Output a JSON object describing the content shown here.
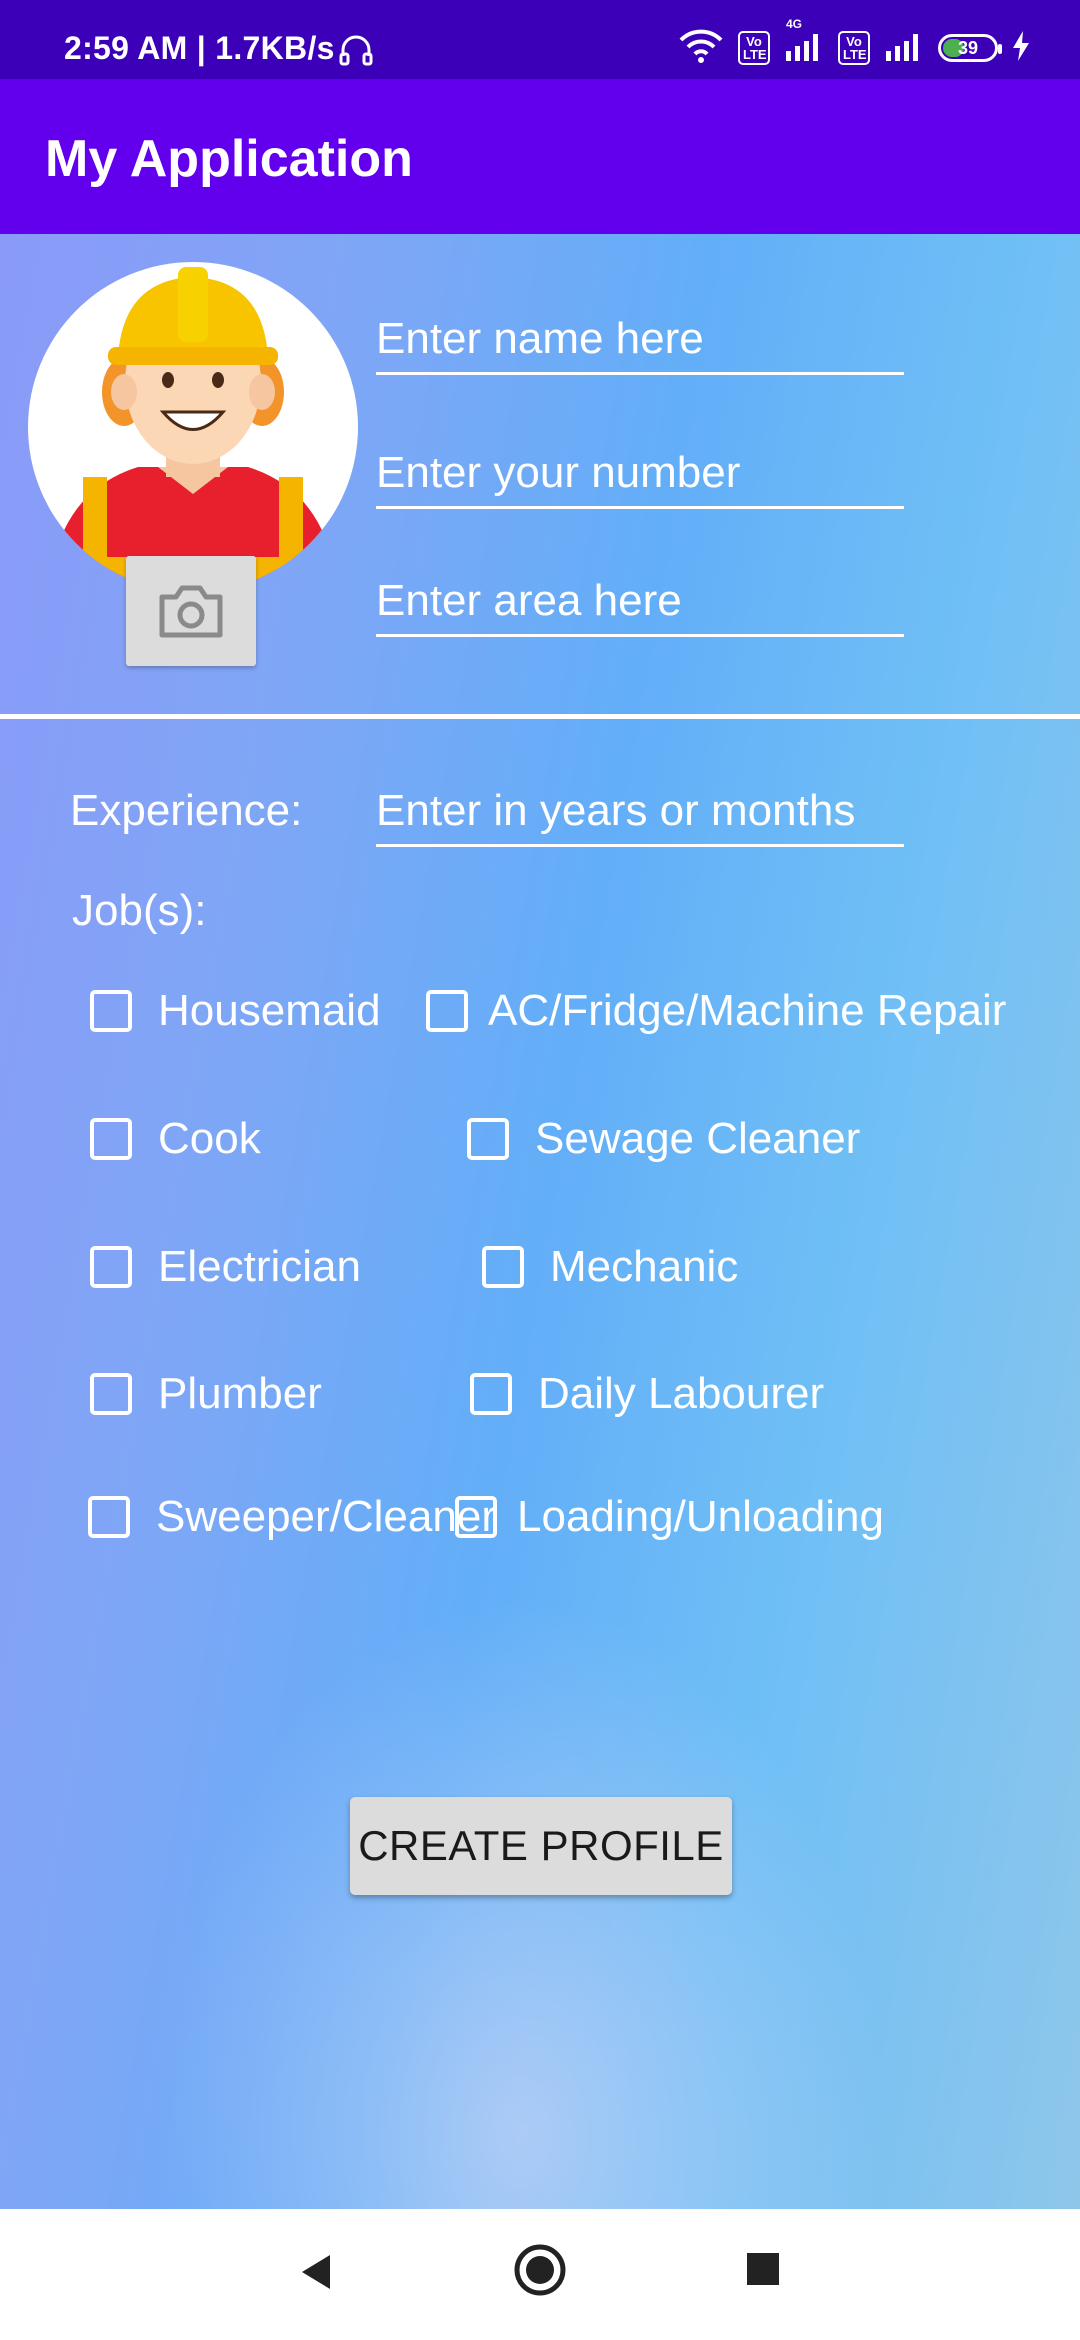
{
  "status_bar": {
    "time": "2:59 AM | 1.7KB/s",
    "volte_1": "Vo LTE",
    "network": "4G",
    "volte_2": "Vo LTE",
    "battery": "39"
  },
  "app_bar": {
    "title": "My Application"
  },
  "profile": {
    "name_placeholder": "Enter name here",
    "number_placeholder": "Enter your number",
    "area_placeholder": "Enter area here"
  },
  "experience": {
    "label": "Experience:",
    "placeholder": "Enter in years or months"
  },
  "jobs": {
    "label": "Job(s):",
    "items": [
      {
        "label": "Housemaid",
        "checked": false
      },
      {
        "label": "AC/Fridge/Machine Repair",
        "checked": false
      },
      {
        "label": "Cook",
        "checked": false
      },
      {
        "label": "Sewage Cleaner",
        "checked": false
      },
      {
        "label": "Electrician",
        "checked": false
      },
      {
        "label": "Mechanic",
        "checked": false
      },
      {
        "label": "Plumber",
        "checked": false
      },
      {
        "label": "Daily Labourer",
        "checked": false
      },
      {
        "label": "Sweeper/Cleaner",
        "checked": false
      },
      {
        "label": "Loading/Unloading",
        "checked": false
      }
    ]
  },
  "create_button": {
    "label": "CREATE PROFILE"
  },
  "nav": {
    "back": "back-icon",
    "home": "home-icon",
    "recents": "recents-icon"
  },
  "colors": {
    "status_bar": "#3c00b8",
    "app_bar": "#6200ee",
    "accent_text": "#ffffff"
  }
}
